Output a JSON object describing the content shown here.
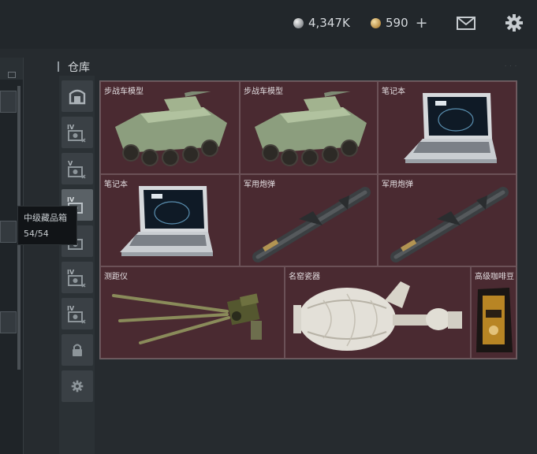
{
  "header": {
    "silver_amount": "4,347K",
    "gold_amount": "590",
    "add_symbol": "+"
  },
  "warehouse": {
    "title": "仓库"
  },
  "tooltip": {
    "name": "中级藏品箱",
    "capacity": "54/54"
  },
  "tabs": [
    {
      "icon": "container-icon",
      "tier": ""
    },
    {
      "icon": "container-icon",
      "tier": "IV"
    },
    {
      "icon": "container-icon",
      "tier": "V"
    },
    {
      "icon": "container-icon",
      "tier": "IV"
    },
    {
      "icon": "container-icon",
      "tier": ""
    },
    {
      "icon": "container-icon",
      "tier": "IV"
    },
    {
      "icon": "container-icon",
      "tier": "IV"
    },
    {
      "icon": "lock-icon",
      "tier": ""
    },
    {
      "icon": "gear-icon",
      "tier": ""
    }
  ],
  "items": [
    {
      "name": "步战车模型",
      "icon": "ifv-model-icon"
    },
    {
      "name": "步战车模型",
      "icon": "ifv-model-icon"
    },
    {
      "name": "笔记本",
      "icon": "laptop-icon"
    },
    {
      "name": "笔记本",
      "icon": "laptop-icon"
    },
    {
      "name": "军用炮弹",
      "icon": "missile-icon"
    },
    {
      "name": "军用炮弹",
      "icon": "missile-icon"
    },
    {
      "name": "测距仪",
      "icon": "rangefinder-icon"
    },
    {
      "name": "名窑瓷器",
      "icon": "porcelain-vase-icon"
    },
    {
      "name": "高级咖啡豆",
      "icon": "coffee-bag-icon"
    }
  ],
  "colors": {
    "cell_bg": "#4a2a31",
    "cell_border": "#6b5157",
    "panel_bg": "#262b2f"
  }
}
